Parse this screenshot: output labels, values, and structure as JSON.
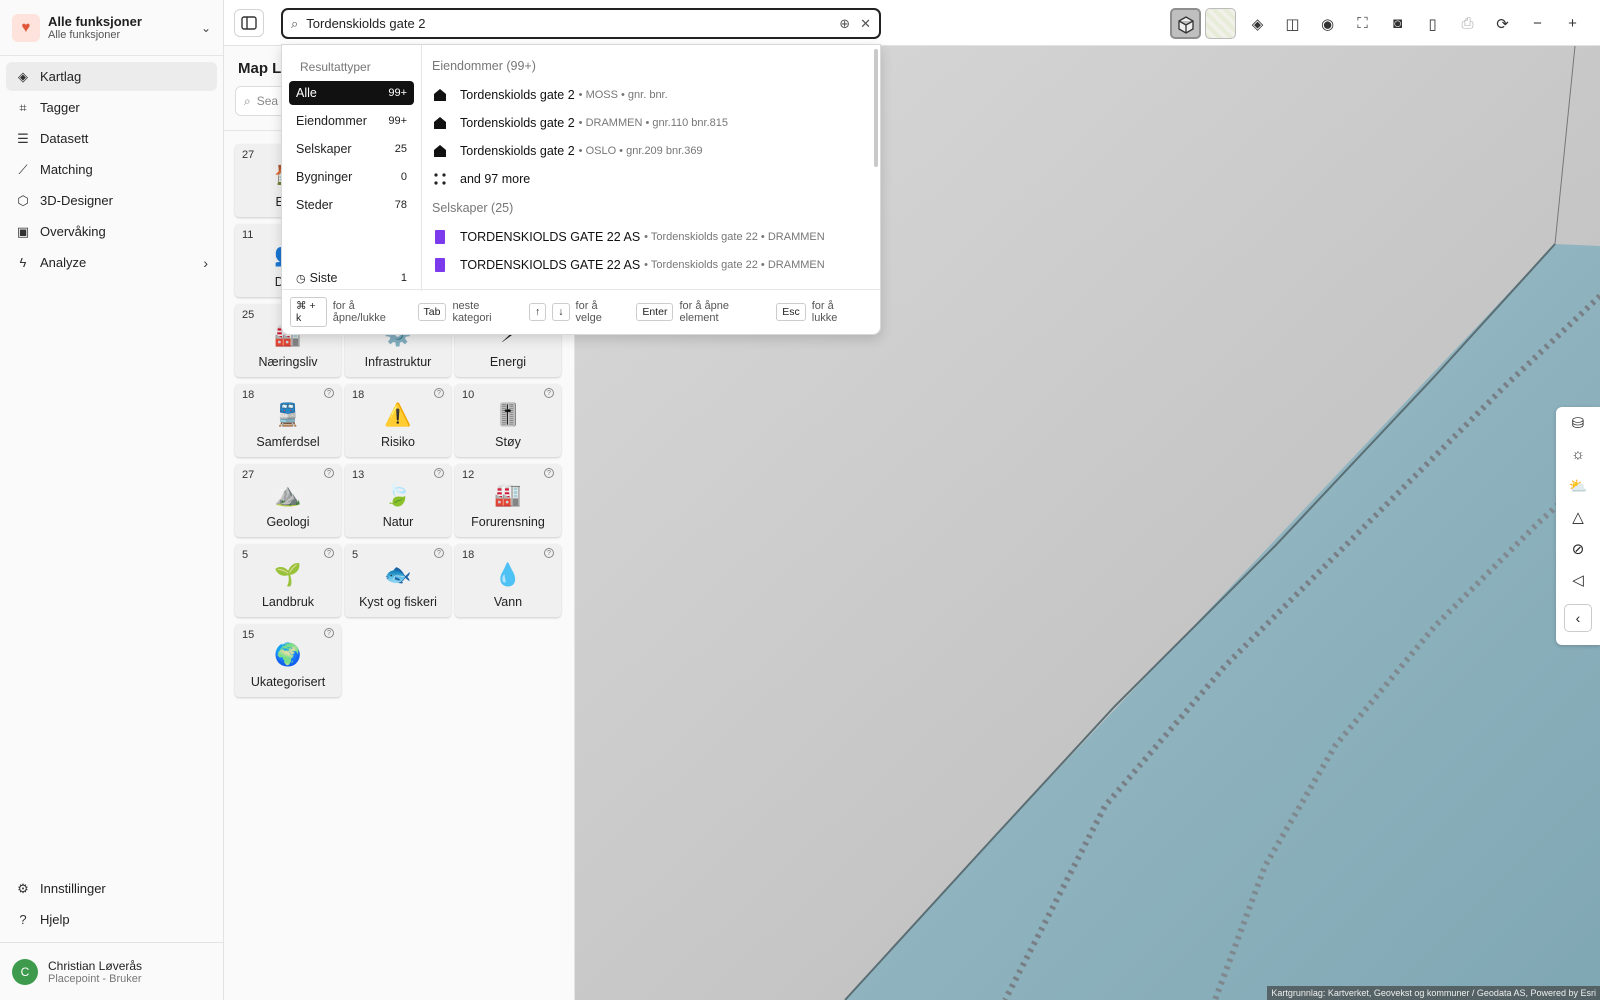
{
  "org": {
    "title": "Alle funksjoner",
    "subtitle": "Alle funksjoner"
  },
  "nav": [
    {
      "label": "Kartlag",
      "icon": "layers-icon",
      "glyph": "◈",
      "active": true
    },
    {
      "label": "Tagger",
      "icon": "tag-icon",
      "glyph": "⌗"
    },
    {
      "label": "Datasett",
      "icon": "list-icon",
      "glyph": "☰"
    },
    {
      "label": "Matching",
      "icon": "trend-icon",
      "glyph": "⟋"
    },
    {
      "label": "3D-Designer",
      "icon": "cube-icon",
      "glyph": "⬡"
    },
    {
      "label": "Overvåking",
      "icon": "monitor-icon",
      "glyph": "▣"
    },
    {
      "label": "Analyze",
      "icon": "lightning-icon",
      "glyph": "ϟ"
    }
  ],
  "sidebar_bottom": [
    {
      "label": "Innstillinger",
      "icon": "gear-icon",
      "glyph": "⚙"
    },
    {
      "label": "Hjelp",
      "icon": "help-icon",
      "glyph": "?"
    }
  ],
  "user": {
    "initial": "C",
    "name": "Christian Løverås",
    "role": "Placepoint - Bruker"
  },
  "panel": {
    "title": "Map La",
    "search_placeholder": "Sea"
  },
  "tiles": [
    {
      "label": "Eien",
      "count": "27",
      "icon": "property-icon",
      "glyph": "🏠"
    },
    {
      "label": "Dem",
      "count": "11",
      "icon": "people-icon",
      "glyph": "👥"
    },
    {
      "label": "Næringsliv",
      "count": "25",
      "icon": "business-icon",
      "glyph": "🏭"
    },
    {
      "label": "Infrastruktur",
      "count": "",
      "icon": "infrastructure-icon",
      "glyph": "⚙️"
    },
    {
      "label": "Energi",
      "count": "",
      "icon": "energy-icon",
      "glyph": "⚡"
    },
    {
      "label": "Samferdsel",
      "count": "18",
      "icon": "train-icon",
      "glyph": "🚆"
    },
    {
      "label": "Risiko",
      "count": "18",
      "icon": "risk-icon",
      "glyph": "⚠️"
    },
    {
      "label": "Støy",
      "count": "10",
      "icon": "noise-gauge-icon",
      "glyph": "🎚️"
    },
    {
      "label": "Geologi",
      "count": "27",
      "icon": "geology-icon",
      "glyph": "⛰️"
    },
    {
      "label": "Natur",
      "count": "13",
      "icon": "leaf-icon",
      "glyph": "🍃"
    },
    {
      "label": "Forurensning",
      "count": "12",
      "icon": "factory-icon",
      "glyph": "🏭"
    },
    {
      "label": "Landbruk",
      "count": "5",
      "icon": "sprout-icon",
      "glyph": "🌱"
    },
    {
      "label": "Kyst og fiskeri",
      "count": "5",
      "icon": "fish-icon",
      "glyph": "🐟"
    },
    {
      "label": "Vann",
      "count": "18",
      "icon": "water-drop-icon",
      "glyph": "💧"
    },
    {
      "label": "Ukategorisert",
      "count": "15",
      "icon": "globe-icon",
      "glyph": "🌍"
    }
  ],
  "search": {
    "value": "Tordenskiolds gate 2"
  },
  "dropdown": {
    "types_heading": "Resultattyper",
    "categories": [
      {
        "label": "Alle",
        "count": "99+",
        "selected": true
      },
      {
        "label": "Eiendommer",
        "count": "99+"
      },
      {
        "label": "Selskaper",
        "count": "25"
      },
      {
        "label": "Bygninger",
        "count": "0"
      },
      {
        "label": "Steder",
        "count": "78"
      }
    ],
    "recent": {
      "label": "Siste",
      "count": "1"
    },
    "groups": [
      {
        "heading": "Eiendommer (99+)",
        "items": [
          {
            "title": "Tordenskiolds gate 2",
            "meta": "• MOSS • gnr. bnr.",
            "icon": "house-icon"
          },
          {
            "title": "Tordenskiolds gate 2",
            "meta": "• DRAMMEN • gnr.110 bnr.815",
            "icon": "house-icon"
          },
          {
            "title": "Tordenskiolds gate 2",
            "meta": "• OSLO • gnr.209 bnr.369",
            "icon": "house-icon"
          },
          {
            "title": "and 97 more",
            "meta": "",
            "icon": "more-icon"
          }
        ]
      },
      {
        "heading": "Selskaper (25)",
        "items": [
          {
            "title": "TORDENSKIOLDS GATE 22 AS",
            "meta": "• Tordenskiolds gate 22 • DRAMMEN",
            "icon": "company-icon"
          },
          {
            "title": "TORDENSKIOLDS GATE 22 AS",
            "meta": "• Tordenskiolds gate 22 • DRAMMEN",
            "icon": "company-icon"
          }
        ]
      }
    ],
    "footer": [
      {
        "keys": [
          "⌘ + k"
        ],
        "text": "for å åpne/lukke"
      },
      {
        "keys": [
          "Tab"
        ],
        "text": "neste kategori"
      },
      {
        "keys": [
          "↑",
          "↓"
        ],
        "text": "for å velge"
      },
      {
        "keys": [
          "Enter"
        ],
        "text": "for å åpne element"
      },
      {
        "keys": [
          "Esc"
        ],
        "text": "for å lukke"
      }
    ]
  },
  "map": {
    "attribution": "Kartgrunnlag: Kartverket, Geovekst og kommuner / Geodata AS, Powered by Esri"
  },
  "colors": {
    "accent_dark": "#111111",
    "company_purple": "#7c3aed",
    "avatar_green": "#3e9b4d",
    "org_red": "#e0573a"
  }
}
